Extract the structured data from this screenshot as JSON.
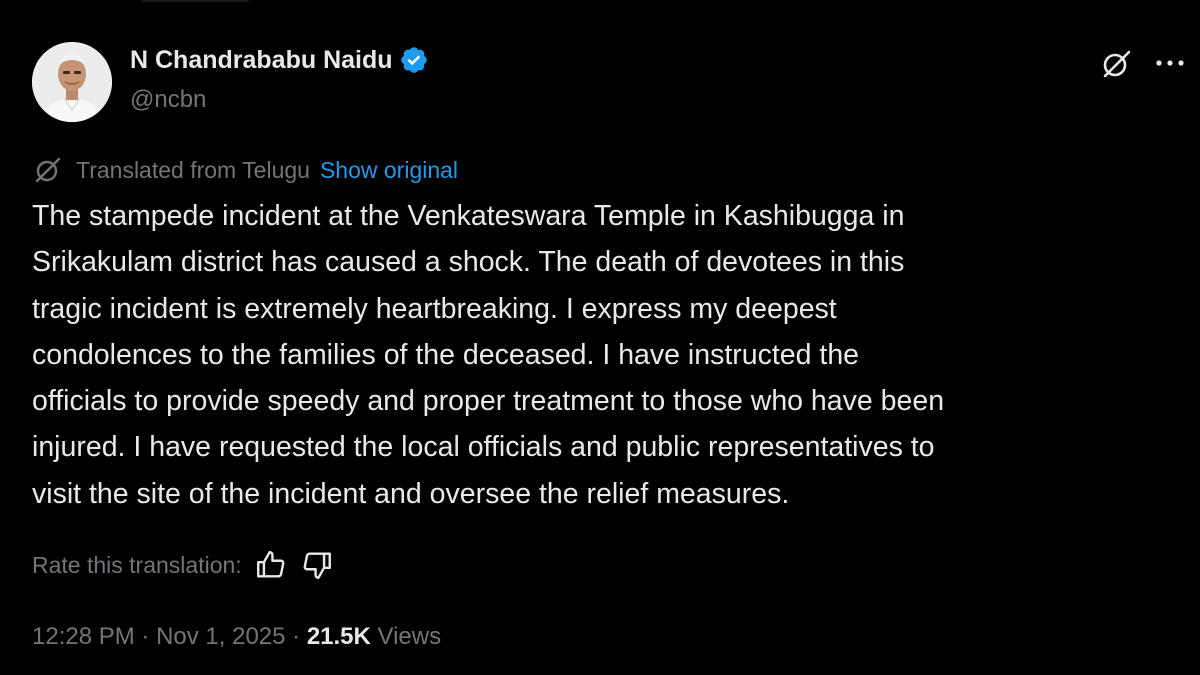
{
  "author": {
    "display_name": "N Chandrababu Naidu",
    "handle": "@ncbn",
    "verified": true
  },
  "icons": {
    "verified": "verified-badge-icon",
    "grok": "grok-icon",
    "more": "more-options-icon",
    "translate": "translate-icon",
    "thumbs_up": "thumbs-up-icon",
    "thumbs_down": "thumbs-down-icon"
  },
  "translation": {
    "label": "Translated from Telugu",
    "show_original": "Show original",
    "rate_label": "Rate this translation:"
  },
  "tweet": {
    "lines": [
      "The stampede incident at the Venkateswara Temple in Kashibugga in",
      "Srikakulam district has caused a shock. The death of devotees in this",
      "tragic incident is extremely heartbreaking. I express my deepest",
      "condolences to the families of the deceased. I have instructed the",
      "officials to provide speedy and proper treatment to those who have been",
      "injured. I have requested the local officials and public representatives to",
      "visit the site of the incident and oversee the relief measures."
    ]
  },
  "meta": {
    "time": "12:28 PM",
    "separator": " · ",
    "date": "Nov 1, 2025",
    "views_count": "21.5K",
    "views_label": " Views"
  },
  "colors": {
    "background": "#000000",
    "text": "#e7e9ea",
    "secondary": "#71767b",
    "link": "#1d9bf0",
    "verified": "#1d9bf0"
  }
}
